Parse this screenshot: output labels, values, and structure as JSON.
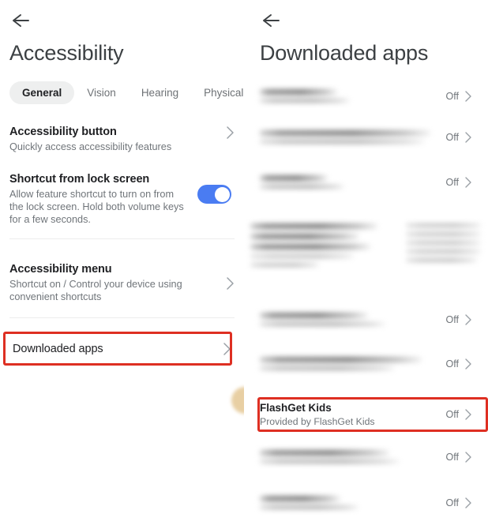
{
  "left_panel": {
    "back_label": "back-arrow",
    "title": "Accessibility",
    "tabs": [
      {
        "label": "General",
        "active": true
      },
      {
        "label": "Vision",
        "active": false
      },
      {
        "label": "Hearing",
        "active": false
      },
      {
        "label": "Physical",
        "active": false
      }
    ],
    "items": [
      {
        "title": "Accessibility button",
        "subtitle": "Quickly access accessibility features",
        "control": "chevron"
      },
      {
        "title": "Shortcut from lock screen",
        "subtitle": "Allow feature shortcut to turn on from the lock screen. Hold both volume keys for a few seconds.",
        "control": "toggle",
        "toggle_on": true
      },
      {
        "title": "Accessibility menu",
        "subtitle": "Shortcut on / Control your device using convenient shortcuts",
        "control": "chevron"
      },
      {
        "title": "Downloaded apps",
        "subtitle": "",
        "control": "chevron",
        "highlighted": true
      }
    ]
  },
  "right_panel": {
    "back_label": "back-arrow",
    "title": "Downloaded apps",
    "status_off": "Off",
    "apps": [
      {
        "name": "",
        "provider": "",
        "status": "Off",
        "blurred": true
      },
      {
        "name": "",
        "provider": "",
        "status": "Off",
        "blurred": true
      },
      {
        "name": "",
        "provider": "",
        "status": "Off",
        "blurred": true
      },
      {
        "name": "",
        "provider": "",
        "status": "",
        "blurred": true
      },
      {
        "name": "",
        "provider": "",
        "status": "Off",
        "blurred": true
      },
      {
        "name": "",
        "provider": "",
        "status": "Off",
        "blurred": true
      },
      {
        "name": "FlashGet Kids",
        "provider": "Provided by FlashGet Kids",
        "status": "Off",
        "blurred": false,
        "highlighted": true
      },
      {
        "name": "",
        "provider": "",
        "status": "Off",
        "blurred": true
      },
      {
        "name": "",
        "provider": "",
        "status": "Off",
        "blurred": true
      }
    ]
  },
  "colors": {
    "highlight_border": "#de2f22",
    "toggle_on": "#4a7cf2",
    "tab_active_bg": "#eeefef",
    "text_primary": "#202124",
    "text_secondary": "#70757a"
  }
}
